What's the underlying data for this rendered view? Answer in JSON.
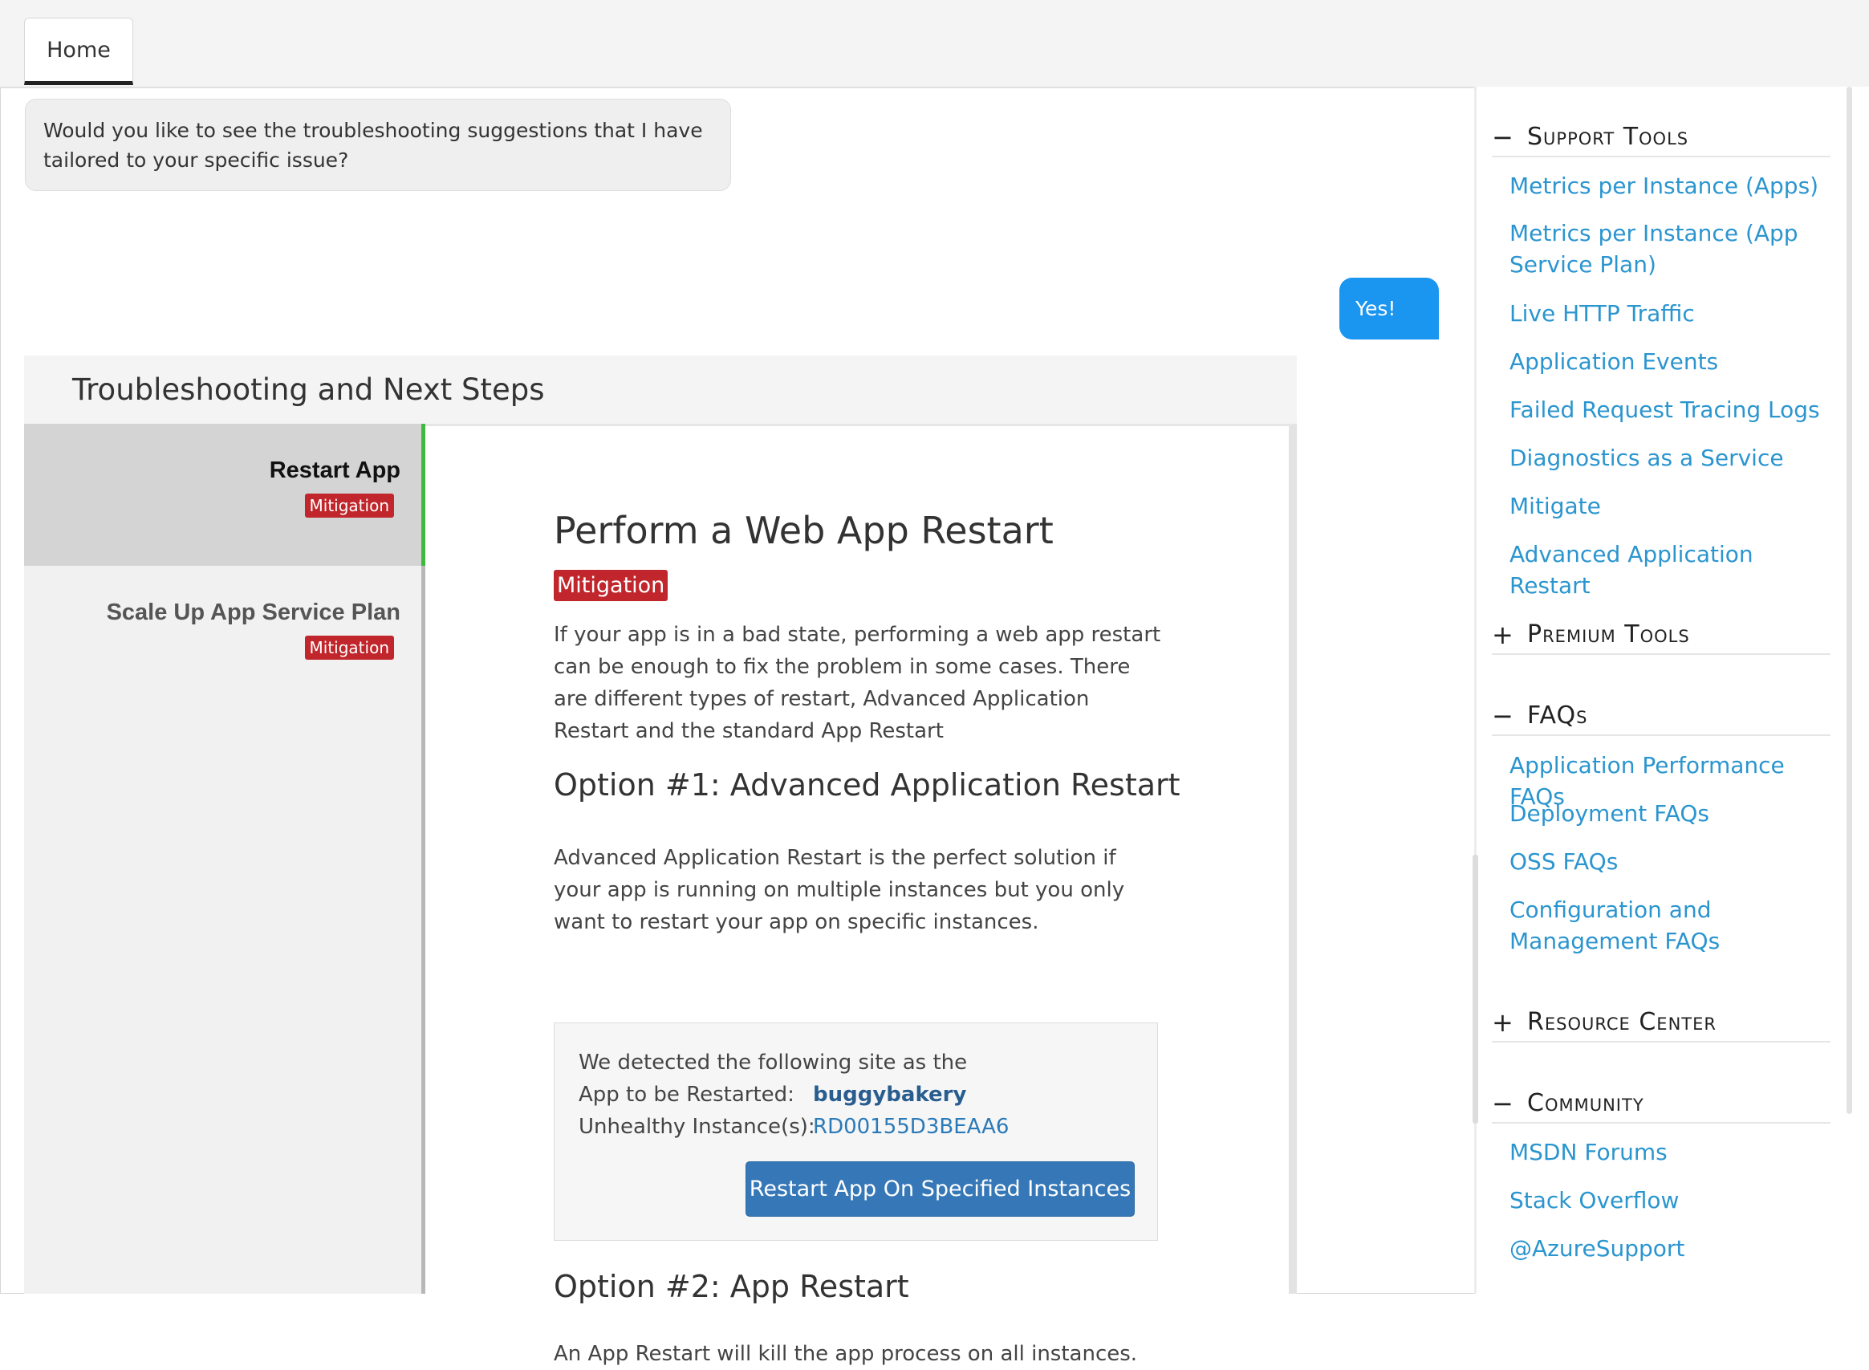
{
  "tabs": {
    "home": "Home"
  },
  "chat": {
    "bot_message": "Would you like to see the troubleshooting suggestions that I have tailored to your specific issue?",
    "user_reply": "Yes!"
  },
  "troubleshooting": {
    "header": "Troubleshooting and Next Steps",
    "steps": [
      {
        "title": "Restart App",
        "badge": "Mitigation"
      },
      {
        "title": "Scale Up App Service Plan",
        "badge": "Mitigation"
      }
    ],
    "detail": {
      "title": "Perform a Web App Restart",
      "badge": "Mitigation",
      "intro": "If your app is in a bad state, performing a web app restart can be enough to fix the problem in some cases. There are different types of restart, Advanced Application Restart and the standard App Restart",
      "option1_title": "Option #1: Advanced Application Restart",
      "option1_text": "Advanced Application Restart is the perfect solution if your app is running on multiple instances but you only want to restart your app on specific instances.",
      "detect_line": "We detected the following site as the",
      "app_label": "App to be Restarted:",
      "app_value": "buggybakery",
      "instance_label": "Unhealthy Instance(s):",
      "instance_value": "RD00155D3BEAA6",
      "restart_button": "Restart App On Specified Instances",
      "option2_title": "Option #2: App Restart",
      "option2_text": "An App Restart will kill the app process on all instances."
    }
  },
  "sidebar": {
    "support_tools": {
      "sign": "−",
      "title": "Support Tools",
      "items": [
        "Metrics per Instance (Apps)",
        "Metrics per Instance (App Service Plan)",
        "Live HTTP Traffic",
        "Application Events",
        "Failed Request Tracing Logs",
        "Diagnostics as a Service",
        "Mitigate",
        "Advanced Application Restart"
      ]
    },
    "premium_tools": {
      "sign": "+",
      "title": "Premium Tools"
    },
    "faqs": {
      "sign": "−",
      "title": "FAQs",
      "items": [
        "Application Performance FAQs",
        "Deployment FAQs",
        "OSS FAQs",
        "Configuration and Management FAQs"
      ]
    },
    "resource_center": {
      "sign": "+",
      "title": "Resource Center"
    },
    "community": {
      "sign": "−",
      "title": "Community",
      "items": [
        "MSDN Forums",
        "Stack Overflow",
        "@AzureSupport"
      ]
    }
  },
  "colors": {
    "link": "#2b95cf",
    "badge": "#c0262b",
    "button": "#3678b7",
    "user_bubble": "#1a95f0",
    "active_step_bar": "#3eb93e"
  }
}
